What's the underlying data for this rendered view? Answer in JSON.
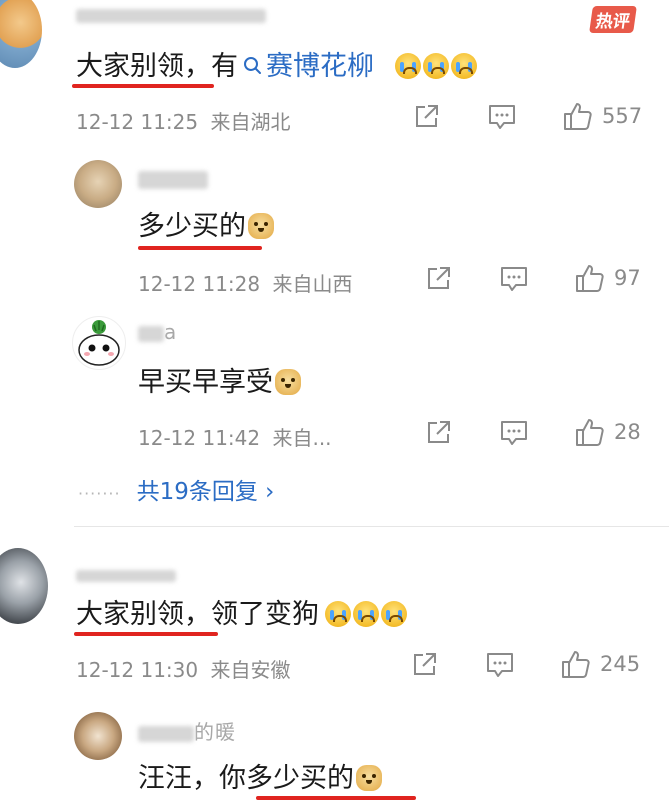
{
  "badge": "热评",
  "comments": [
    {
      "text_main": "大家别领，有",
      "search_link": "赛博花柳",
      "time": "12-12 11:25",
      "location": "来自湖北",
      "likes": "557"
    },
    {
      "text_main": "多少买的",
      "time": "12-12 11:28",
      "location": "来自山西",
      "likes": "97"
    },
    {
      "username_fragment": "a",
      "text_main": "早买早享受",
      "time": "12-12 11:42",
      "location": "来自...",
      "likes": "28"
    },
    {
      "text_main": "大家别领，领了变狗",
      "time": "12-12 11:30",
      "location": "来自安徽",
      "likes": "245"
    },
    {
      "username_fragment": "的暖",
      "text_main": "汪汪，你多少买的"
    }
  ],
  "more_replies": "共19条回复 ›",
  "emoji": {
    "crying": "crying-emoji",
    "doge": "doge-emoji"
  },
  "colors": {
    "underline": "#e0241f",
    "link": "#2b6cc4",
    "meta": "#8a8a8a"
  }
}
